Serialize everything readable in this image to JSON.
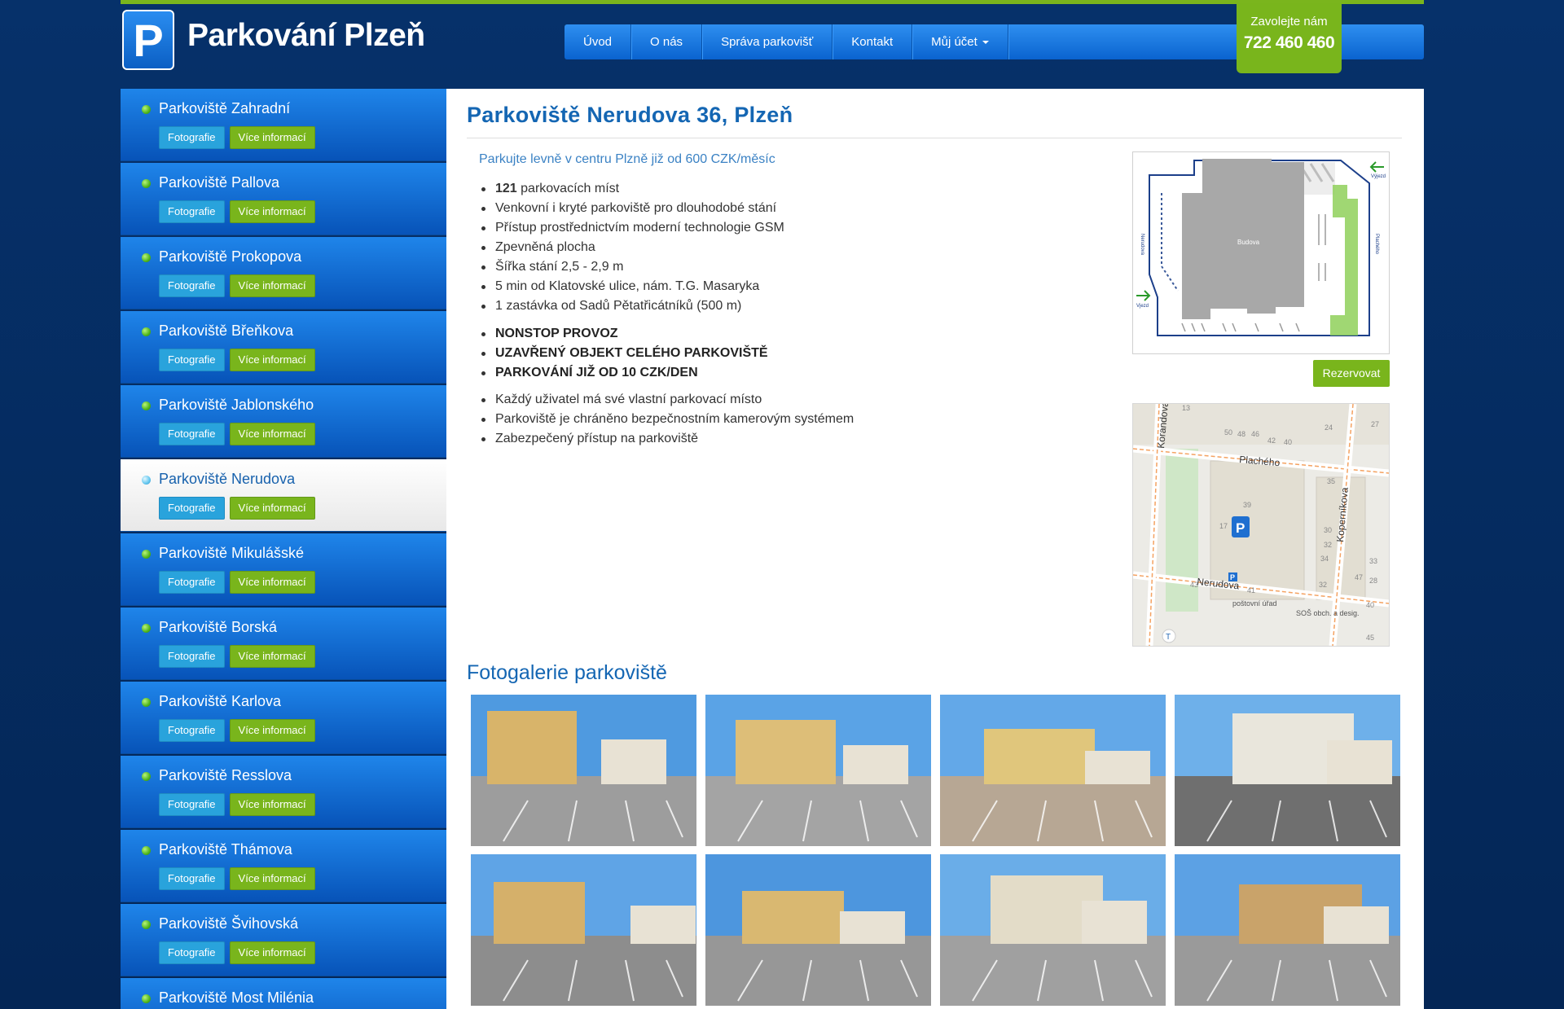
{
  "header": {
    "brand": "Parkování Plzeň",
    "nav": [
      "Úvod",
      "O nás",
      "Správa parkovišť",
      "Kontakt",
      "Můj účet"
    ],
    "call_label": "Zavolejte nám",
    "call_number": "722 460 460"
  },
  "sidebar": {
    "photo_label": "Fotografie",
    "info_label": "Více informací",
    "items": [
      {
        "label": "Parkoviště Zahradní",
        "active": false
      },
      {
        "label": "Parkoviště Pallova",
        "active": false
      },
      {
        "label": "Parkoviště Prokopova",
        "active": false
      },
      {
        "label": "Parkoviště Břeňkova",
        "active": false
      },
      {
        "label": "Parkoviště Jablonského",
        "active": false
      },
      {
        "label": "Parkoviště Nerudova",
        "active": true
      },
      {
        "label": "Parkoviště Mikulášské",
        "active": false
      },
      {
        "label": "Parkoviště Borská",
        "active": false
      },
      {
        "label": "Parkoviště Karlova",
        "active": false
      },
      {
        "label": "Parkoviště Resslova",
        "active": false
      },
      {
        "label": "Parkoviště Thámova",
        "active": false
      },
      {
        "label": "Parkoviště Švihovská",
        "active": false
      },
      {
        "label": "Parkoviště Most Milénia",
        "active": false
      }
    ]
  },
  "main": {
    "title": "Parkoviště Nerudova 36, Plzeň",
    "lead": "Parkujte levně v centru Plzně již od 600 CZK/měsíc",
    "capacity_number": "121",
    "capacity_text": " parkovacích míst",
    "features": [
      "Venkovní i kryté parkoviště pro dlouhodobé stání",
      "Přístup prostřednictvím moderní technologie GSM",
      "Zpevněná plocha",
      "Šířka stání 2,5 - 2,9 m",
      "5 min od Klatovské ulice, nám. T.G. Masaryka",
      "1 zastávka od Sadů Pětatřicátníků (500 m)"
    ],
    "highlights": [
      "NONSTOP PROVOZ",
      "UZAVŘENÝ OBJEKT CELÉHO PARKOVIŠTĚ",
      "PARKOVÁNÍ JIŽ OD 10 CZK/DEN"
    ],
    "more": [
      "Každý uživatel má své vlastní parkovací místo",
      "Parkoviště je chráněno bezpečnostním kamerovým systémem",
      "Zabezpečený přístup na parkoviště"
    ],
    "reserve_label": "Rezervovat",
    "gallery_title": "Fotogalerie parkoviště"
  },
  "diagram": {
    "building": "Budova",
    "entry": "Vjezd",
    "exit": "Výjezd",
    "street_left": "Nerudova",
    "street_right": "Plachého"
  },
  "map": {
    "streets": [
      "Korandova",
      "Plachého",
      "Nerudova",
      "Koperníkova"
    ],
    "pois": [
      "poštovní úřad",
      "SOŠ obch. a desig."
    ],
    "numbers": [
      "13",
      "50",
      "48",
      "46",
      "42",
      "40",
      "24",
      "27",
      "35",
      "39",
      "17",
      "30",
      "32",
      "34",
      "43",
      "41",
      "28",
      "45",
      "40",
      "47",
      "32",
      "33"
    ]
  },
  "colors": {
    "brand_blue": "#1466b3",
    "accent_green": "#79b51c",
    "photo_blue": "#29a3dc",
    "background": "#06316a"
  },
  "icons": {
    "logo": "parking-p-icon",
    "bullet": "green-dot-icon",
    "active_bullet": "blue-dot-icon"
  }
}
